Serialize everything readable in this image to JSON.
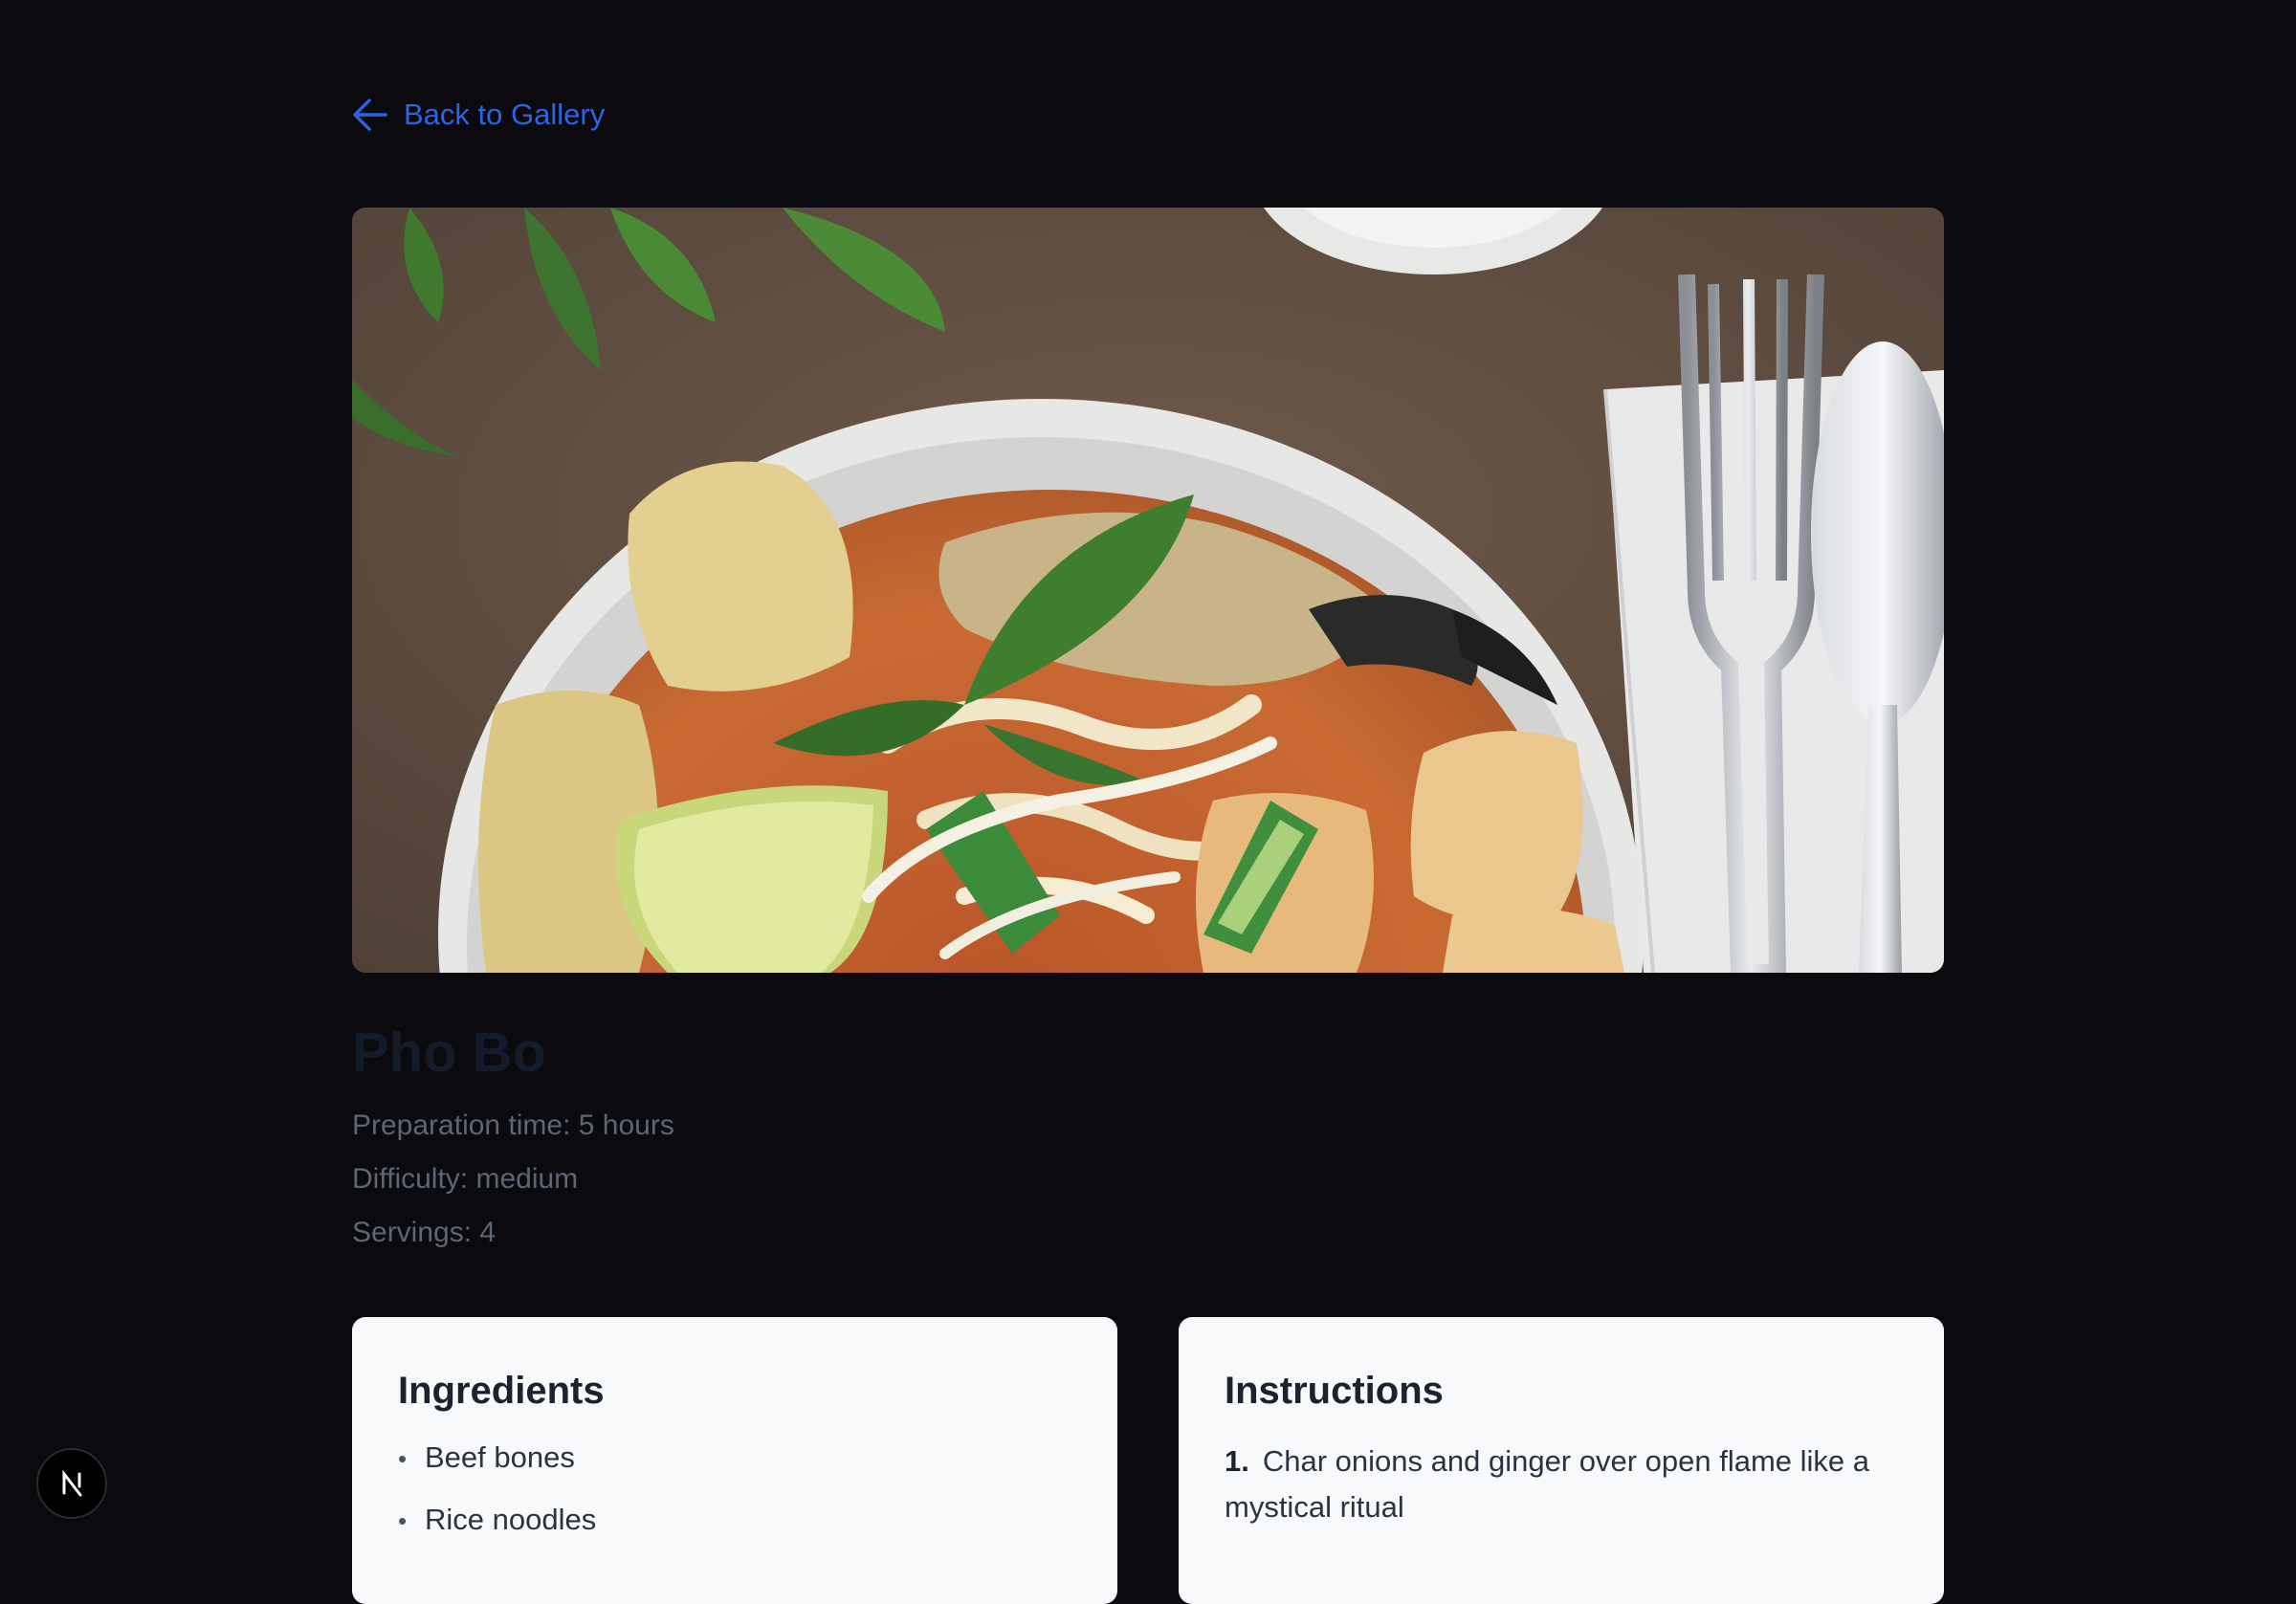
{
  "nav": {
    "back_label": "Back to Gallery"
  },
  "recipe": {
    "title": "Pho Bo",
    "preparation_time": "Preparation time: 5 hours",
    "difficulty": "Difficulty: medium",
    "servings": "Servings: 4"
  },
  "ingredients": {
    "heading": "Ingredients",
    "items": [
      "Beef bones",
      "Rice noodles"
    ]
  },
  "instructions": {
    "heading": "Instructions",
    "steps": [
      {
        "number": "1.",
        "text": "Char onions and ginger over open flame like a mystical ritual"
      }
    ]
  },
  "colors": {
    "background": "#0a0a0f",
    "link": "#2f63e6",
    "card": "#f8f9fb"
  },
  "icons": {
    "back": "arrow-left-icon",
    "badge": "nextjs-logo-icon"
  }
}
